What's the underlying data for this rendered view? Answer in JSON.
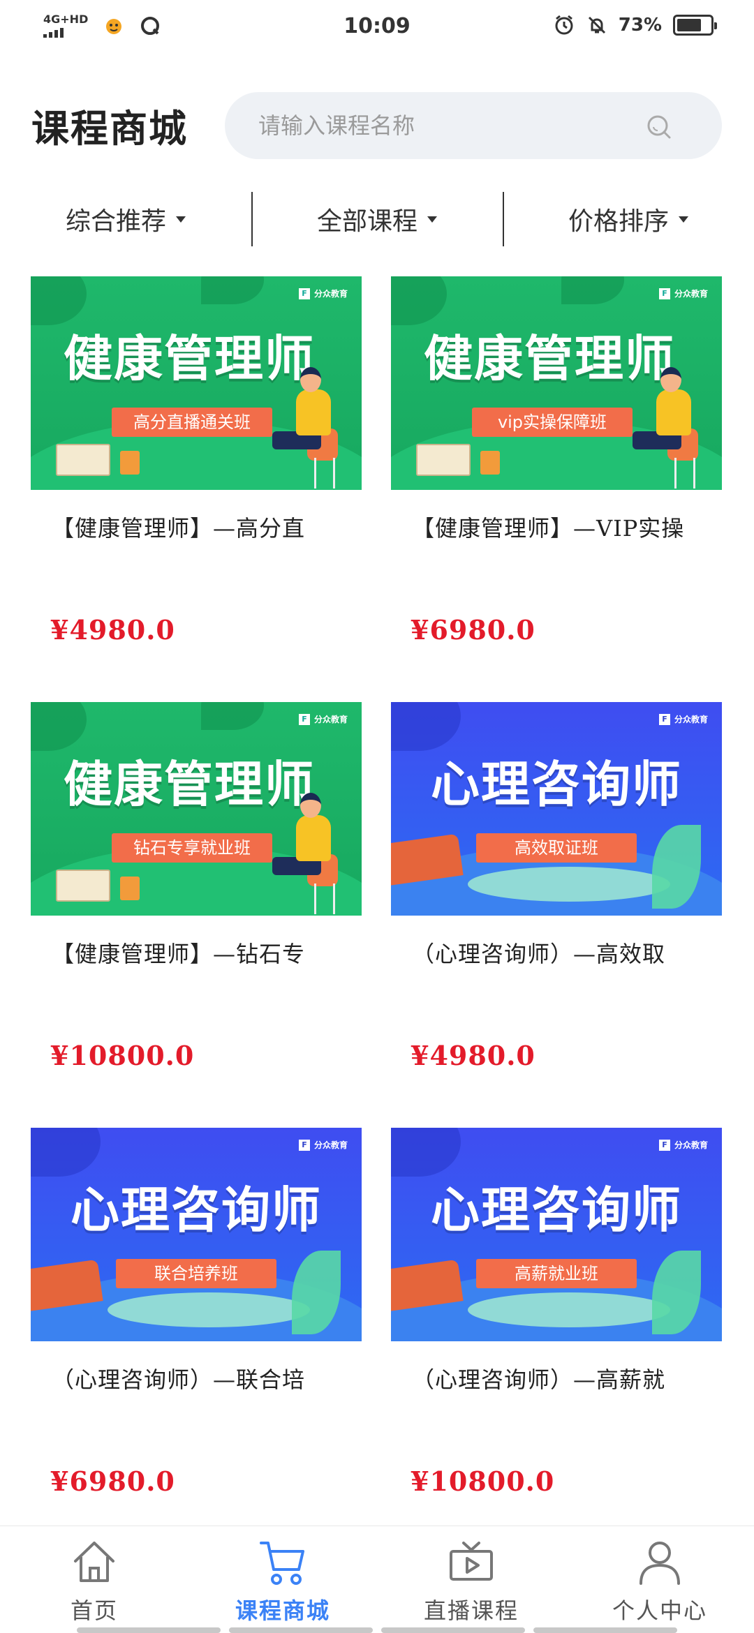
{
  "status_bar": {
    "network": "4G+HD",
    "time": "10:09",
    "battery_percent": "73%",
    "battery_level": 0.73
  },
  "header": {
    "title": "课程商城",
    "search_placeholder": "请输入课程名称"
  },
  "filters": [
    {
      "label": "综合推荐"
    },
    {
      "label": "全部课程"
    },
    {
      "label": "价格排序"
    }
  ],
  "courses": [
    {
      "banner_title": "健康管理师",
      "banner_tag": "高分直播通关班",
      "brand": "分众教育",
      "name": "【健康管理师】—高分直",
      "price": "¥4980.0",
      "theme": "green"
    },
    {
      "banner_title": "健康管理师",
      "banner_tag": "vip实操保障班",
      "brand": "分众教育",
      "name": "【健康管理师】—VIP实操",
      "price": "¥6980.0",
      "theme": "green"
    },
    {
      "banner_title": "健康管理师",
      "banner_tag": "钻石专享就业班",
      "brand": "分众教育",
      "name": "【健康管理师】—钻石专",
      "price": "¥10800.0",
      "theme": "green"
    },
    {
      "banner_title": "心理咨询师",
      "banner_tag": "高效取证班",
      "brand": "分众教育",
      "name": "（心理咨询师）—高效取",
      "price": "¥4980.0",
      "theme": "blue"
    },
    {
      "banner_title": "心理咨询师",
      "banner_tag": "联合培养班",
      "brand": "分众教育",
      "name": "（心理咨询师）—联合培",
      "price": "¥6980.0",
      "theme": "blue"
    },
    {
      "banner_title": "心理咨询师",
      "banner_tag": "高薪就业班",
      "brand": "分众教育",
      "name": "（心理咨询师）—高薪就",
      "price": "¥10800.0",
      "theme": "blue"
    }
  ],
  "tab_bar": {
    "tabs": [
      {
        "label": "首页",
        "icon": "home-icon"
      },
      {
        "label": "课程商城",
        "icon": "cart-icon",
        "active": true
      },
      {
        "label": "直播课程",
        "icon": "live-video-icon"
      },
      {
        "label": "个人中心",
        "icon": "person-icon"
      }
    ]
  },
  "colors": {
    "accent": "#3b82f6",
    "price": "#e31b2a",
    "green_banner": "#1fb86b",
    "blue_banner": "#3f4df1"
  }
}
